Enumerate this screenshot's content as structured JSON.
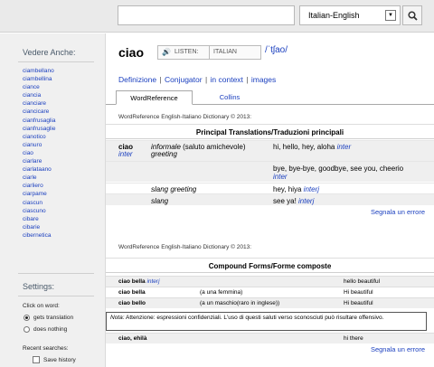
{
  "search": {
    "placeholder": "",
    "value": ""
  },
  "dict_select": {
    "value": "Italian-English"
  },
  "sidebar": {
    "see_also_title": "Vedere Anche:",
    "see_also": [
      "ciambellano",
      "ciambellina",
      "ciance",
      "ciancia",
      "cianciare",
      "ciancicare",
      "cianfrusaglia",
      "cianfrusaglie",
      "cianotico",
      "cianuro",
      "ciao",
      "ciarlare",
      "ciarlataano",
      "ciarle",
      "ciarliero",
      "ciarpame",
      "ciascun",
      "ciascuno",
      "cibare",
      "cibarie",
      "cibernetica"
    ],
    "settings_title": "Settings:",
    "click_label": "Click on word:",
    "opt_translation": "gets translation",
    "opt_nothing": "does nothing",
    "recent_label": "Recent searches:",
    "save_history": "Save history"
  },
  "entry": {
    "headword": "ciao",
    "listen": "LISTEN:",
    "language": "ITALIAN",
    "ipa": "/ˈtʃao/",
    "nav": {
      "def": "Definizione",
      "conj": "Conjugator",
      "context": "in context",
      "images": "images"
    }
  },
  "tabs": {
    "wordreference": "WordReference",
    "collins": "Collins"
  },
  "section1": {
    "copyright": "WordReference English-Italiano Dictionary © 2013:",
    "title": "Principal Translations/Traduzioni principali",
    "rows": [
      {
        "it": "ciao",
        "pos": "inter",
        "note": "informale",
        "note2": "(saluto amichevole)",
        "en": "hi, hello, hey, aloha",
        "en_pos": "inter"
      },
      {
        "note": "greeting"
      },
      {
        "en": "bye, bye-bye, goodbye, see you, cheerio",
        "en_pos": "inter"
      },
      {
        "note": "slang greeting",
        "en": "hey, hiya",
        "en_pos": "interj"
      },
      {
        "note": "slang",
        "en": "see ya!",
        "en_pos": "interj"
      }
    ],
    "error": "Segnala un errore"
  },
  "section2": {
    "copyright": "WordReference English-Italiano Dictionary © 2013:",
    "title": "Compound Forms/Forme composte",
    "rows": [
      {
        "it": "ciao bella",
        "pos": "interj",
        "ctx": "",
        "en": "hello beautiful"
      },
      {
        "it": "ciao bella",
        "pos": "",
        "ctx": "(a una femmina)",
        "en": "Hi beautiful"
      },
      {
        "it": "ciao bello",
        "pos": "",
        "ctx": "(a un maschio(raro in inglese))",
        "en": "Hi beautiful"
      }
    ],
    "note_label": "Nota:",
    "note_text": "Attenzione: espressioni confidenziali. L'uso di questi saluti verso sconosciuti può risultare offensivo.",
    "last_it": "ciao, ehilà",
    "last_en": "hi there",
    "error": "Segnala un errore"
  }
}
